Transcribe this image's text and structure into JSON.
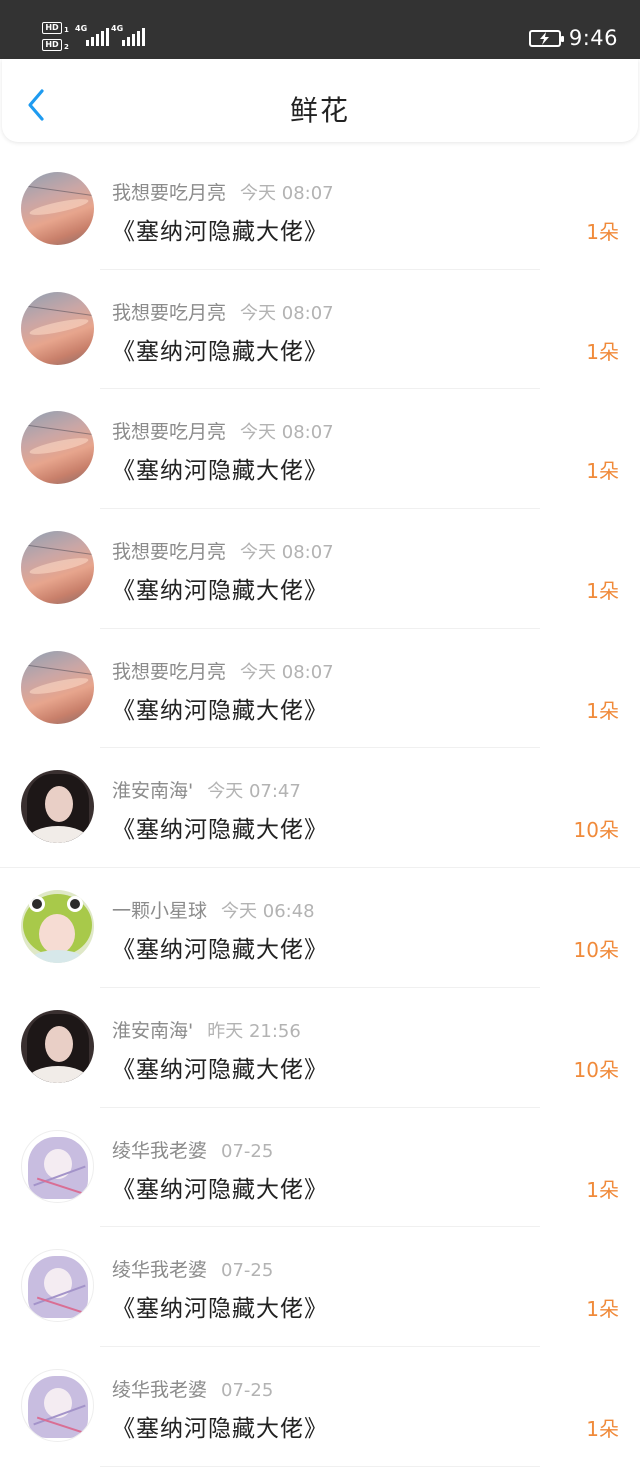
{
  "status_bar": {
    "hd1": "HD",
    "sim1": "1",
    "hd2": "HD",
    "sim2": "2",
    "net1": "4G",
    "net2": "4G",
    "time": "9:46"
  },
  "header": {
    "title": "鲜花",
    "back_icon": "chevron-left-icon",
    "back_color": "#1e9bf0"
  },
  "colors": {
    "accent_orange": "#f08a3a",
    "name_gray": "#8c8c8c",
    "time_gray": "#b3b3b3"
  },
  "items": [
    {
      "avatar": "sunset",
      "name": "我想要吃月亮",
      "time": "今天 08:07",
      "title": "《塞纳河隐藏大佬》",
      "count": "1朵"
    },
    {
      "avatar": "sunset",
      "name": "我想要吃月亮",
      "time": "今天 08:07",
      "title": "《塞纳河隐藏大佬》",
      "count": "1朵"
    },
    {
      "avatar": "sunset",
      "name": "我想要吃月亮",
      "time": "今天 08:07",
      "title": "《塞纳河隐藏大佬》",
      "count": "1朵"
    },
    {
      "avatar": "sunset",
      "name": "我想要吃月亮",
      "time": "今天 08:07",
      "title": "《塞纳河隐藏大佬》",
      "count": "1朵"
    },
    {
      "avatar": "sunset",
      "name": "我想要吃月亮",
      "time": "今天 08:07",
      "title": "《塞纳河隐藏大佬》",
      "count": "1朵"
    },
    {
      "avatar": "girl",
      "name": "淮安南海'",
      "time": "今天 07:47",
      "title": "《塞纳河隐藏大佬》",
      "count": "10朵"
    },
    {
      "avatar": "frog",
      "name": "一颗小星球",
      "time": "今天 06:48",
      "title": "《塞纳河隐藏大佬》",
      "count": "10朵"
    },
    {
      "avatar": "girl",
      "name": "淮安南海'",
      "time": "昨天 21:56",
      "title": "《塞纳河隐藏大佬》",
      "count": "10朵"
    },
    {
      "avatar": "anime",
      "name": "绫华我老婆",
      "time": "07-25",
      "title": "《塞纳河隐藏大佬》",
      "count": "1朵"
    },
    {
      "avatar": "anime",
      "name": "绫华我老婆",
      "time": "07-25",
      "title": "《塞纳河隐藏大佬》",
      "count": "1朵"
    },
    {
      "avatar": "anime",
      "name": "绫华我老婆",
      "time": "07-25",
      "title": "《塞纳河隐藏大佬》",
      "count": "1朵"
    }
  ]
}
